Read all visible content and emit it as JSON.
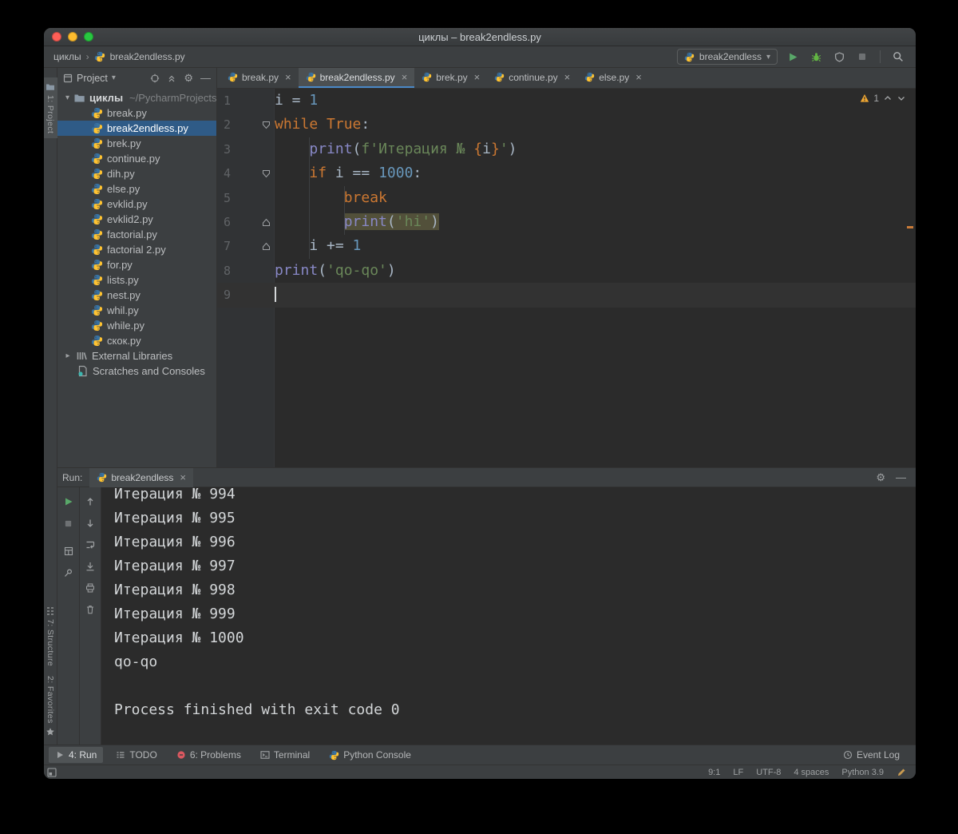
{
  "window": {
    "title": "циклы – break2endless.py"
  },
  "icons": {
    "chevron_down": "▾",
    "chevron_right": "▸",
    "gear": "⚙",
    "hide": "—",
    "close": "×",
    "crumb_separator": "›"
  },
  "toolbar": {
    "breadcrumb_root": "циклы",
    "breadcrumb_file": "break2endless.py",
    "run_config": "break2endless"
  },
  "left_stripe": {
    "project": "1: Project",
    "structure": "7: Structure",
    "favorites": "2: Favorites"
  },
  "project": {
    "header": "Project",
    "root_name": "циклы",
    "root_path": "~/PycharmProjects",
    "selected": "break2endless.py",
    "files": [
      "break.py",
      "break2endless.py",
      "brek.py",
      "continue.py",
      "dih.py",
      "else.py",
      "evklid.py",
      "evklid2.py",
      "factorial.py",
      "factorial 2.py",
      "for.py",
      "lists.py",
      "nest.py",
      "whil.py",
      "while.py",
      "скок.py"
    ],
    "external_libraries": "External Libraries",
    "scratches": "Scratches and Consoles"
  },
  "editor": {
    "tabs": [
      {
        "label": "break.py",
        "active": false
      },
      {
        "label": "break2endless.py",
        "active": true
      },
      {
        "label": "brek.py",
        "active": false
      },
      {
        "label": "continue.py",
        "active": false
      },
      {
        "label": "else.py",
        "active": false
      }
    ],
    "warning_count": "1",
    "lines": [
      {
        "num": "1",
        "fold": "",
        "tokens": [
          {
            "t": "i = ",
            "s": "d"
          },
          {
            "t": "1",
            "s": "n"
          }
        ]
      },
      {
        "num": "2",
        "fold": "down",
        "tokens": [
          {
            "t": "while ",
            "s": "k"
          },
          {
            "t": "True",
            "s": "k"
          },
          {
            "t": ":",
            "s": "d"
          }
        ]
      },
      {
        "num": "3",
        "fold": "",
        "tokens": [
          {
            "t": "    ",
            "s": "d"
          },
          {
            "t": "print",
            "s": "f"
          },
          {
            "t": "(",
            "s": "d"
          },
          {
            "t": "f",
            "s": "s"
          },
          {
            "t": "'Итерация № ",
            "s": "s"
          },
          {
            "t": "{",
            "s": "k"
          },
          {
            "t": "i",
            "s": "d"
          },
          {
            "t": "}",
            "s": "k"
          },
          {
            "t": "'",
            "s": "s"
          },
          {
            "t": ")",
            "s": "d"
          }
        ]
      },
      {
        "num": "4",
        "fold": "down",
        "tokens": [
          {
            "t": "    ",
            "s": "d"
          },
          {
            "t": "if ",
            "s": "k"
          },
          {
            "t": "i == ",
            "s": "d"
          },
          {
            "t": "1000",
            "s": "n"
          },
          {
            "t": ":",
            "s": "d"
          }
        ]
      },
      {
        "num": "5",
        "fold": "",
        "tokens": [
          {
            "t": "        ",
            "s": "d"
          },
          {
            "t": "break",
            "s": "k"
          }
        ]
      },
      {
        "num": "6",
        "fold": "up",
        "tokens": [
          {
            "t": "        ",
            "s": "d"
          },
          {
            "t": "print",
            "s": "f",
            "w": true
          },
          {
            "t": "(",
            "s": "d",
            "w": true
          },
          {
            "t": "'hi'",
            "s": "s",
            "w": true
          },
          {
            "t": ")",
            "s": "d",
            "w": true
          }
        ]
      },
      {
        "num": "7",
        "fold": "up",
        "tokens": [
          {
            "t": "    ",
            "s": "d"
          },
          {
            "t": "i += ",
            "s": "d"
          },
          {
            "t": "1",
            "s": "n"
          }
        ]
      },
      {
        "num": "8",
        "fold": "",
        "tokens": [
          {
            "t": "print",
            "s": "f"
          },
          {
            "t": "(",
            "s": "d"
          },
          {
            "t": "'qo-qo'",
            "s": "s"
          },
          {
            "t": ")",
            "s": "d"
          }
        ]
      },
      {
        "num": "9",
        "fold": "",
        "current": true,
        "caret": true,
        "tokens": []
      }
    ]
  },
  "run_panel": {
    "label": "Run:",
    "tab": "break2endless",
    "console": [
      "Итерация № 994",
      "Итерация № 995",
      "Итерация № 996",
      "Итерация № 997",
      "Итерация № 998",
      "Итерация № 999",
      "Итерация № 1000",
      "qo-qo",
      "",
      "Process finished with exit code 0"
    ]
  },
  "bottom_bar": {
    "run": "4: Run",
    "todo": "TODO",
    "problems": "6: Problems",
    "terminal": "Terminal",
    "python_console": "Python Console",
    "event_log": "Event Log"
  },
  "status_bar": {
    "caret": "9:1",
    "line_sep": "LF",
    "encoding": "UTF-8",
    "indent": "4 spaces",
    "interpreter": "Python 3.9"
  },
  "colors": {
    "keyword": "#CC7832",
    "number": "#6897BB",
    "string": "#6A8759",
    "builtin": "#8888C6",
    "selection": "#2F5B87",
    "warning_line_bg": "#52503A",
    "run_green": "#59A869"
  }
}
